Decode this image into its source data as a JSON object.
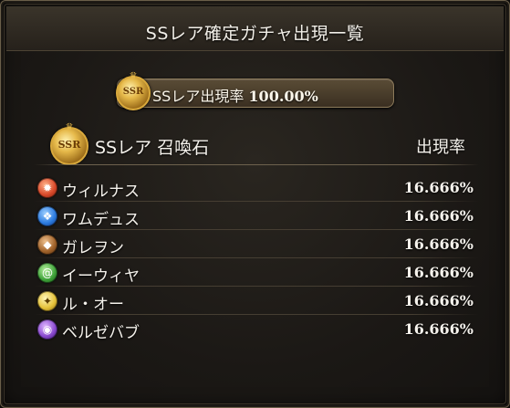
{
  "title": "SSレア確定ガチャ出現一覧",
  "rate_banner": {
    "label": "SSレア出現率",
    "value": "100.00%",
    "badge_text": "SSR"
  },
  "table": {
    "category_badge": "SSR",
    "category_label": "SSレア 召喚石",
    "rate_header": "出現率",
    "items": [
      {
        "name": "ウィルナス",
        "rate": "16.666%",
        "element": "fire",
        "color": "#d9492a"
      },
      {
        "name": "ワムデュス",
        "rate": "16.666%",
        "element": "water",
        "color": "#2c7be0"
      },
      {
        "name": "ガレヲン",
        "rate": "16.666%",
        "element": "earth",
        "color": "#a0622a"
      },
      {
        "name": "イーウィヤ",
        "rate": "16.666%",
        "element": "wind",
        "color": "#3fa33a"
      },
      {
        "name": "ル・オー",
        "rate": "16.666%",
        "element": "light",
        "color": "#e5c23a"
      },
      {
        "name": "ベルゼバブ",
        "rate": "16.666%",
        "element": "dark",
        "color": "#8a4ad0"
      }
    ]
  }
}
